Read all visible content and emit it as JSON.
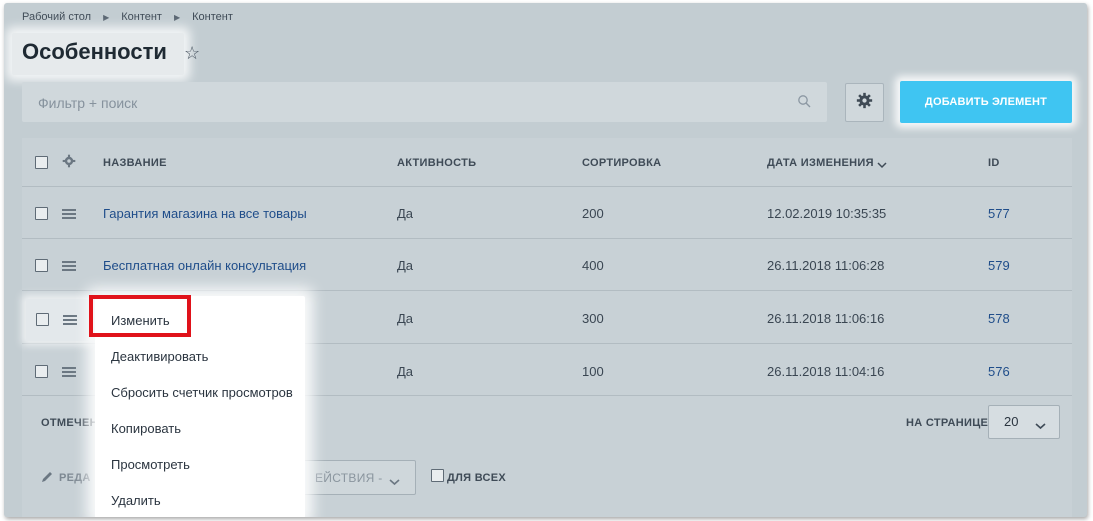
{
  "breadcrumb": [
    "Рабочий стол",
    "Контент",
    "Контент"
  ],
  "page_title": "Особенности",
  "filter": {
    "placeholder": "Фильтр + поиск"
  },
  "add_button": "ДОБАВИТЬ ЭЛЕМЕНТ",
  "columns": [
    "НАЗВАНИЕ",
    "АКТИВНОСТЬ",
    "СОРТИРОВКА",
    "ДАТА ИЗМЕНЕНИЯ",
    "ID"
  ],
  "rows": [
    {
      "name": "Гарантия магазина на все товары",
      "active": "Да",
      "sort": "200",
      "date": "12.02.2019 10:35:35",
      "id": "577"
    },
    {
      "name": "Бесплатная онлайн консультация",
      "active": "Да",
      "sort": "400",
      "date": "26.11.2018 11:06:28",
      "id": "579"
    },
    {
      "name": "",
      "active": "Да",
      "sort": "300",
      "date": "26.11.2018 11:06:16",
      "id": "578"
    },
    {
      "name": "",
      "active": "Да",
      "sort": "100",
      "date": "26.11.2018 11:04:16",
      "id": "576"
    }
  ],
  "footer": {
    "marked_label": "ОТМЕЧЕН",
    "per_page_label": "НА СТРАНИЦЕ:",
    "per_page_value": "20"
  },
  "bottom": {
    "edit_label": "РЕДА",
    "actions_label": "ЕЙСТВИЯ -",
    "for_all_label": "ДЛЯ ВСЕХ"
  },
  "context_menu": [
    "Изменить",
    "Деактивировать",
    "Сбросить счетчик просмотров",
    "Копировать",
    "Просмотреть",
    "Удалить"
  ],
  "colors": {
    "accent": "#3fc5f2",
    "highlight": "#e0121a",
    "link": "#1f4d8a"
  },
  "icons": [
    "chevron-right-icon",
    "star-icon",
    "search-icon",
    "gear-icon",
    "chevron-down-icon",
    "hamburger-icon",
    "pencil-icon"
  ]
}
